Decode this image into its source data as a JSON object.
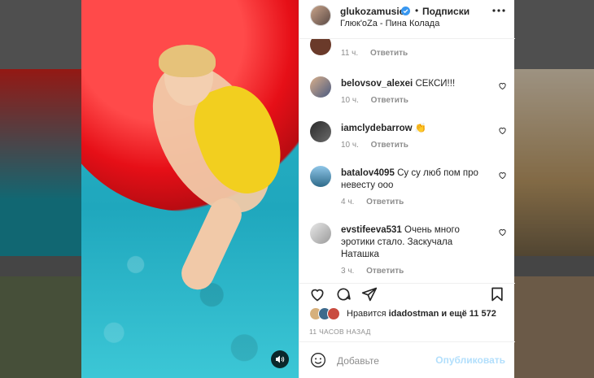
{
  "post": {
    "username": "glukozamusic",
    "follow_label": "Подписки",
    "subtitle": "Глюк'oZa - Пина Колада"
  },
  "comments": [
    {
      "username": "",
      "text": "",
      "time": "11 ч.",
      "reply": "Ответить"
    },
    {
      "username": "belovsov_alexei",
      "text": "СЕКСИ!!!",
      "time": "10 ч.",
      "reply": "Ответить"
    },
    {
      "username": "iamclydebarrow",
      "text": "👏",
      "time": "10 ч.",
      "reply": "Ответить"
    },
    {
      "username": "batalov4095",
      "text": "Су су люб пом про невесту ооо",
      "time": "4 ч.",
      "reply": "Ответить"
    },
    {
      "username": "evstifeeva531",
      "text": "Очень много эротики стало. Заскучала Наташка",
      "time": "3 ч.",
      "reply": "Ответить"
    }
  ],
  "likes": {
    "prefix": "Нравится",
    "user": "idadostman",
    "suffix": "и ещё 11 572"
  },
  "time_ago": "11 ЧАСОВ НАЗАД",
  "comment_box": {
    "placeholder": "Добавьте",
    "publish_label": "Опубликовать"
  },
  "colors": {
    "verified": "#3897f0",
    "publish_disabled": "#b2dffc"
  },
  "icons": [
    "verified-icon",
    "more-icon",
    "heart-icon",
    "comment-icon",
    "share-icon",
    "bookmark-icon",
    "emoji-icon",
    "sound-icon"
  ]
}
